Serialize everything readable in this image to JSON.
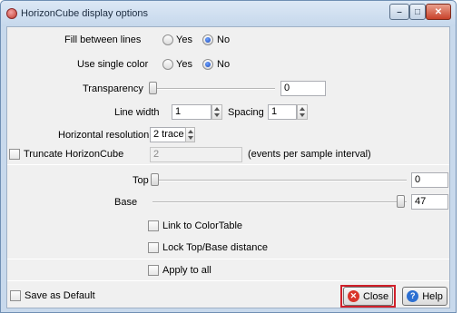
{
  "window": {
    "title": "HorizonCube display options"
  },
  "fill_between": {
    "label": "Fill between lines",
    "options": [
      "Yes",
      "No"
    ],
    "selected": "No"
  },
  "single_color": {
    "label": "Use single color",
    "options": [
      "Yes",
      "No"
    ],
    "selected": "No"
  },
  "transparency": {
    "label": "Transparency",
    "value": "0",
    "slider_fraction": 0.0
  },
  "line_width": {
    "label": "Line width",
    "value": "1"
  },
  "spacing": {
    "label": "Spacing",
    "value": "1"
  },
  "hres": {
    "label": "Horizontal resolution",
    "value": "2 trace"
  },
  "truncate": {
    "label": "Truncate HorizonCube",
    "checked": false,
    "value": "2",
    "units": "(events per sample interval)"
  },
  "top": {
    "label": "Top",
    "value": "0",
    "slider_fraction": 0.0
  },
  "base": {
    "label": "Base",
    "value": "47",
    "slider_fraction": 1.0
  },
  "link_colortable": {
    "label": "Link to ColorTable",
    "checked": false
  },
  "lock_top_base": {
    "label": "Lock Top/Base distance",
    "checked": false
  },
  "apply_all": {
    "label": "Apply to all",
    "checked": false
  },
  "save_default": {
    "label": "Save as Default",
    "checked": false
  },
  "buttons": {
    "close": "Close",
    "help": "Help"
  },
  "colors": {
    "highlight": "#d0202a",
    "close_icon": "#d9342b",
    "help_icon": "#2c6fd1"
  }
}
